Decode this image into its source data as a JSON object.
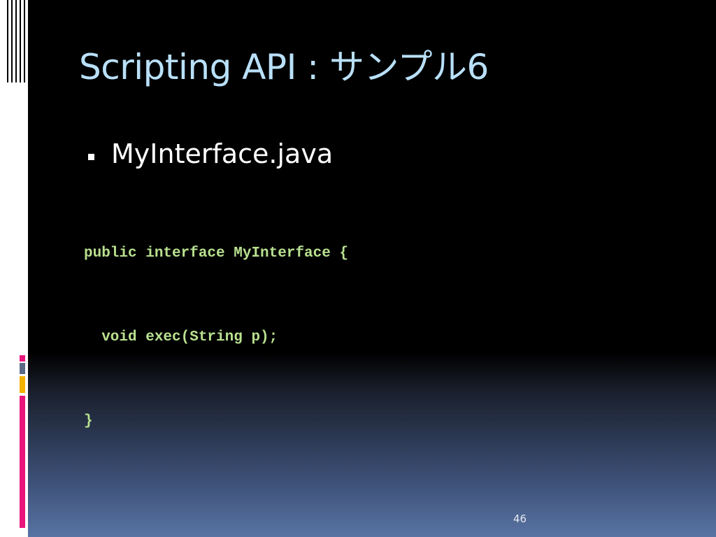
{
  "slide": {
    "title": "Scripting API : サンプル6",
    "bullet": "MyInterface.java",
    "code_lines": [
      "public interface MyInterface {",
      "  void exec(String p);",
      "}"
    ],
    "page_number": "46"
  },
  "colors": {
    "title": "#b9e0f8",
    "code": "#b8e08f",
    "accent_pink": "#e8157a",
    "accent_gold": "#f3b100",
    "accent_gray": "#5a6a85"
  }
}
